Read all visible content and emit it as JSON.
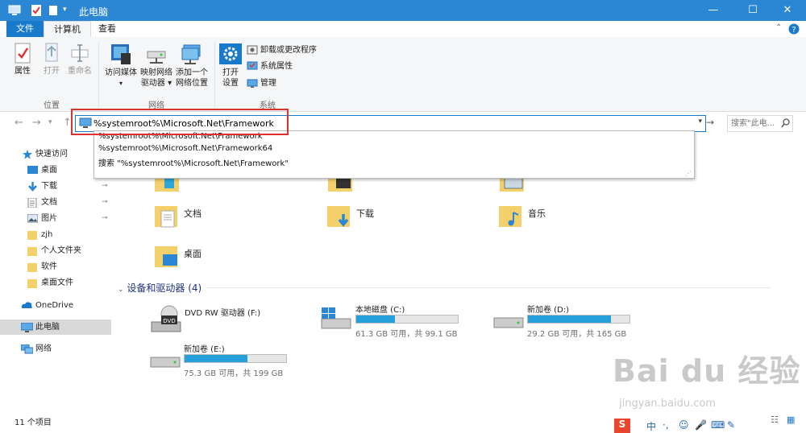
{
  "window": {
    "title": "此电脑",
    "controls": [
      "—",
      "☐",
      "✕"
    ]
  },
  "ribbon": {
    "tabs": [
      "文件",
      "计算机",
      "查看"
    ],
    "location_group": {
      "label": "位置",
      "buttons": [
        "属性",
        "打开",
        "重命名"
      ]
    },
    "network_group": {
      "label": "网络",
      "access_media": "访问媒体",
      "map_drive_line1": "映射网络",
      "map_drive_line2": "驱动器",
      "add_location_line1": "添加一个",
      "add_location_line2": "网络位置"
    },
    "system_group": {
      "label": "系统",
      "open_settings_line1": "打开",
      "open_settings_line2": "设置",
      "uninstall": "卸载或更改程序",
      "system_properties": "系统属性",
      "manage": "管理"
    }
  },
  "address": {
    "value": "%systemroot%\\Microsoft.Net\\Framework",
    "search_placeholder": "搜索\"此电..."
  },
  "autocomplete": [
    "%systemroot%\\Microsoft.Net\\Framework",
    "%systemroot%\\Microsoft.Net\\Framework64",
    "搜索 \"%systemroot%\\Microsoft.Net\\Framework\""
  ],
  "navpane": {
    "quick_access": "快速访问",
    "items": [
      "桌面",
      "下载",
      "文档",
      "图片",
      "zjh",
      "个人文件夹",
      "软件",
      "桌面文件"
    ],
    "onedrive": "OneDrive",
    "this_pc": "此电脑",
    "network": "网络"
  },
  "folders": [
    "文档",
    "下载",
    "音乐",
    "桌面"
  ],
  "devices": {
    "header": "设备和驱动器 (4)",
    "drives": [
      {
        "name": "DVD RW 驱动器 (F:)",
        "free": "",
        "used_fraction": null
      },
      {
        "name": "本地磁盘 (C:)",
        "free": "61.3 GB 可用，共 99.1 GB",
        "used_fraction": 0.38
      },
      {
        "name": "新加卷 (D:)",
        "free": "29.2 GB 可用，共 165 GB",
        "used_fraction": 0.82
      },
      {
        "name": "新加卷 (E:)",
        "free": "75.3 GB 可用，共 199 GB",
        "used_fraction": 0.62
      }
    ]
  },
  "status": {
    "count": "11 个项目"
  },
  "watermark": {
    "brand": "Bai du 经验",
    "url": "jingyan.baidu.com"
  },
  "ime": {
    "lang": "中"
  },
  "colors": {
    "titlebar": "#2b87d3",
    "accent": "#1979ca",
    "highlight": "#e03030",
    "drive_fill": "#26a0da"
  }
}
